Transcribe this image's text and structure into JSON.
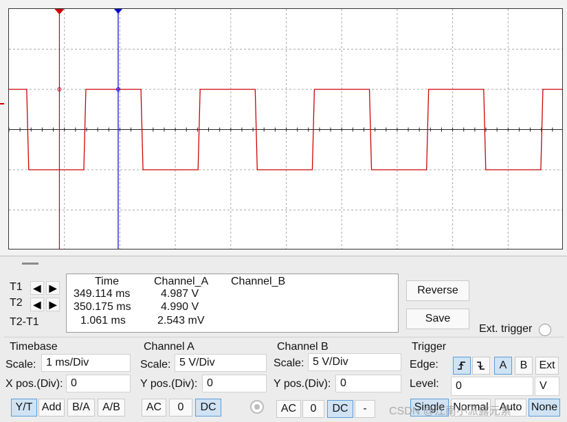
{
  "cursors": {
    "t1_label": "T1",
    "t2_label": "T2",
    "diff_label": "T2-T1"
  },
  "readout": {
    "headers": {
      "time": "Time",
      "channel_a": "Channel_A",
      "channel_b": "Channel_B"
    },
    "rows": [
      {
        "time": "349.114 ms",
        "channel_a": "4.987 V",
        "channel_b": ""
      },
      {
        "time": "350.175 ms",
        "channel_a": "4.990 V",
        "channel_b": ""
      },
      {
        "time": "1.061 ms",
        "channel_a": "2.543 mV",
        "channel_b": ""
      }
    ]
  },
  "buttons": {
    "reverse": "Reverse",
    "save": "Save",
    "ext_trigger": "Ext. trigger"
  },
  "timebase": {
    "title": "Timebase",
    "scale_label": "Scale:",
    "scale_value": "1 ms/Div",
    "xpos_label": "X pos.(Div):",
    "xpos_value": "0",
    "modes": [
      "Y/T",
      "Add",
      "B/A",
      "A/B"
    ],
    "active_mode": "Y/T"
  },
  "channel_a": {
    "title": "Channel A",
    "scale_label": "Scale:",
    "scale_value": "5  V/Div",
    "ypos_label": "Y pos.(Div):",
    "ypos_value": "0",
    "coupling": [
      "AC",
      "0",
      "DC"
    ],
    "active_coupling": "DC"
  },
  "channel_b": {
    "title": "Channel B",
    "scale_label": "Scale:",
    "scale_value": "5  V/Div",
    "ypos_label": "Y pos.(Div):",
    "ypos_value": "0",
    "coupling": [
      "AC",
      "0",
      "DC",
      "-"
    ],
    "active_coupling": "DC"
  },
  "trigger": {
    "title": "Trigger",
    "edge_label": "Edge:",
    "sources": [
      "A",
      "B",
      "Ext"
    ],
    "active_source": "A",
    "level_label": "Level:",
    "level_value": "0",
    "level_unit": "V",
    "modes": [
      "Single",
      "Normal",
      "Auto",
      "None"
    ],
    "active_modes": [
      "Single",
      "None"
    ]
  },
  "watermark": "CSDN @江南小派露元素",
  "colors": {
    "channel_a": "#cc0000",
    "cursor_t1": "#cc0000",
    "cursor_t2": "#0000cc",
    "active_button": "#cfe3f5"
  },
  "waveform": {
    "type": "square",
    "channel": "A",
    "high_divs": 1,
    "low_divs": -1,
    "period_divs": 2,
    "cursor_t1_divs": 0.91,
    "cursor_t2_divs": 1.97
  }
}
